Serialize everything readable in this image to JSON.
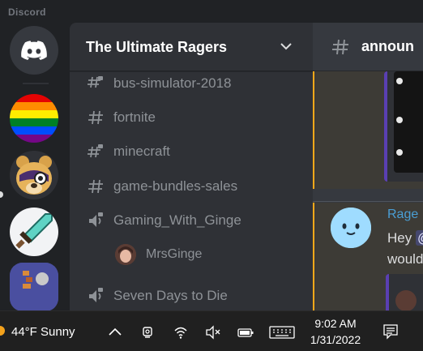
{
  "window": {
    "app_name": "Discord"
  },
  "servers": [
    {
      "name": "home",
      "icon": "discord-logo-icon"
    },
    {
      "name": "rainbow-server",
      "icon": "rainbow-flag-icon"
    },
    {
      "name": "bear-server",
      "icon": "bear-avatar-icon"
    },
    {
      "name": "sword-server",
      "icon": "diamond-sword-icon"
    },
    {
      "name": "blue-server",
      "icon": "server-art-icon"
    }
  ],
  "sidebar": {
    "server_name": "The Ultimate Ragers",
    "channels": [
      {
        "label": "bus-simulator-2018",
        "type": "text-locked"
      },
      {
        "label": "fortnite",
        "type": "text"
      },
      {
        "label": "minecraft",
        "type": "text-locked"
      },
      {
        "label": "game-bundles-sales",
        "type": "text"
      },
      {
        "label": "Gaming_With_Ginge",
        "type": "voice-locked"
      },
      {
        "label": "Seven Days to Die",
        "type": "voice-locked"
      }
    ],
    "voice_users": [
      {
        "name": "MrsGinge"
      }
    ]
  },
  "chat": {
    "channel_name": "announ",
    "message": {
      "author": "Rage",
      "line1_prefix": "Hey ",
      "mention": "@",
      "line2": "would"
    }
  },
  "taskbar": {
    "weather": "44°F  Sunny",
    "time": "9:02 AM",
    "date": "1/31/2022"
  },
  "colors": {
    "bg_dark": "#202225",
    "sidebar": "#2f3136",
    "chat": "#36393f",
    "mention_highlight": "#faa81a",
    "author_blue": "#4a9fd5",
    "taskbar": "#202020"
  }
}
